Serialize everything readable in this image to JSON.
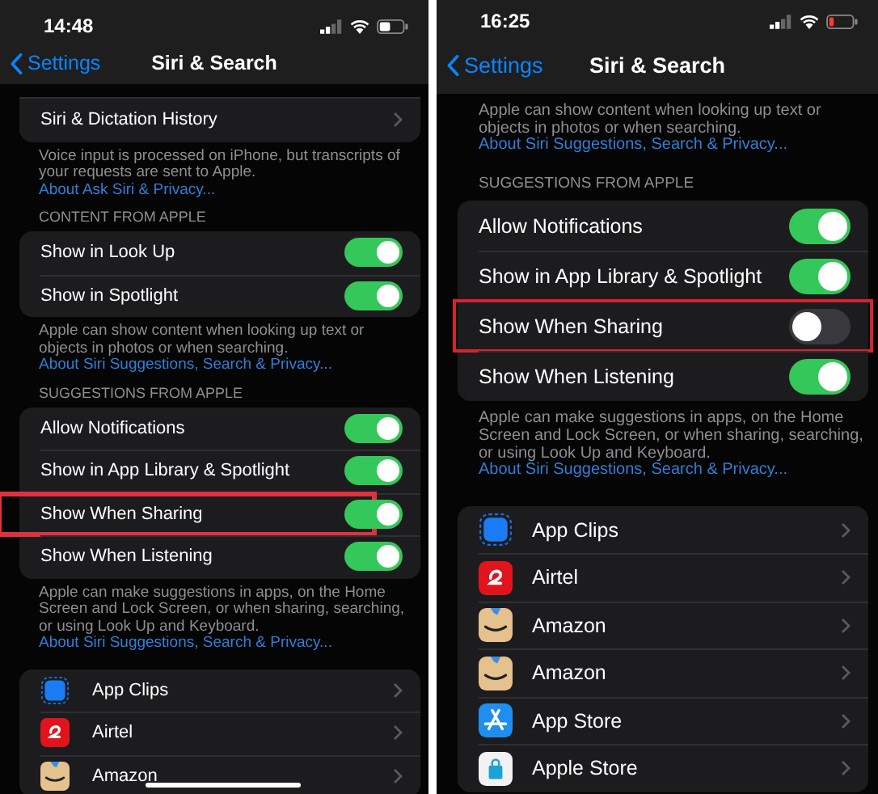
{
  "phones": [
    {
      "time": "14:48",
      "battery_low": false,
      "home_indicator": true,
      "back_label": "Settings",
      "title": "Siri & Search",
      "blocks": [
        {
          "kind": "card",
          "rows": [
            {
              "kind": "link",
              "label": "Siri & Dictation History"
            }
          ]
        },
        {
          "kind": "footer",
          "text": "Voice input is processed on iPhone, but transcripts of your requests are sent to Apple.",
          "link": "About Ask Siri & Privacy..."
        },
        {
          "kind": "header",
          "text": "CONTENT FROM APPLE"
        },
        {
          "kind": "card",
          "rows": [
            {
              "kind": "toggle",
              "label": "Show in Look Up",
              "on": true,
              "highlighted": false
            },
            {
              "kind": "toggle",
              "label": "Show in Spotlight",
              "on": true,
              "highlighted": false
            }
          ]
        },
        {
          "kind": "footer",
          "text": "Apple can show content when looking up text or objects in photos or when searching.",
          "link": "About Siri Suggestions, Search & Privacy..."
        },
        {
          "kind": "header",
          "text": "SUGGESTIONS FROM APPLE"
        },
        {
          "kind": "card",
          "rows": [
            {
              "kind": "toggle",
              "label": "Allow Notifications",
              "on": true,
              "highlighted": false
            },
            {
              "kind": "toggle",
              "label": "Show in App Library & Spotlight",
              "on": true,
              "highlighted": false
            },
            {
              "kind": "toggle",
              "label": "Show When Sharing",
              "on": true,
              "highlighted": true
            },
            {
              "kind": "toggle",
              "label": "Show When Listening",
              "on": true,
              "highlighted": false
            }
          ]
        },
        {
          "kind": "footer",
          "text": "Apple can make suggestions in apps, on the Home Screen and Lock Screen, or when sharing, searching, or using Look Up and Keyboard.",
          "link": "About Siri Suggestions, Search & Privacy..."
        },
        {
          "kind": "card",
          "rows": [
            {
              "kind": "clips",
              "label": "App Clips"
            },
            {
              "kind": "airtel",
              "label": "Airtel"
            },
            {
              "kind": "amazon",
              "label": "Amazon"
            }
          ]
        }
      ]
    },
    {
      "time": "16:25",
      "battery_low": true,
      "home_indicator": false,
      "back_label": "Settings",
      "title": "Siri & Search",
      "blocks": [
        {
          "kind": "footer",
          "text": "Apple can show content when looking up text or objects in photos or when searching.",
          "link": "About Siri Suggestions, Search & Privacy..."
        },
        {
          "kind": "header",
          "text": "SUGGESTIONS FROM APPLE"
        },
        {
          "kind": "card",
          "rows": [
            {
              "kind": "toggle",
              "label": "Allow Notifications",
              "on": true,
              "highlighted": false
            },
            {
              "kind": "toggle",
              "label": "Show in App Library & Spotlight",
              "on": true,
              "highlighted": false
            },
            {
              "kind": "toggle",
              "label": "Show When Sharing",
              "on": false,
              "highlighted": true
            },
            {
              "kind": "toggle",
              "label": "Show When Listening",
              "on": true,
              "highlighted": false
            }
          ]
        },
        {
          "kind": "footer",
          "text": "Apple can make suggestions in apps, on the Home Screen and Lock Screen, or when sharing, searching, or using Look Up and Keyboard.",
          "link": "About Siri Suggestions, Search & Privacy..."
        },
        {
          "kind": "card",
          "rows": [
            {
              "kind": "clips",
              "label": "App Clips"
            },
            {
              "kind": "airtel",
              "label": "Airtel"
            },
            {
              "kind": "amazon",
              "label": "Amazon"
            },
            {
              "kind": "amazon",
              "label": "Amazon"
            },
            {
              "kind": "appstore",
              "label": "App Store"
            },
            {
              "kind": "applestore",
              "label": "Apple Store"
            }
          ]
        }
      ]
    }
  ]
}
